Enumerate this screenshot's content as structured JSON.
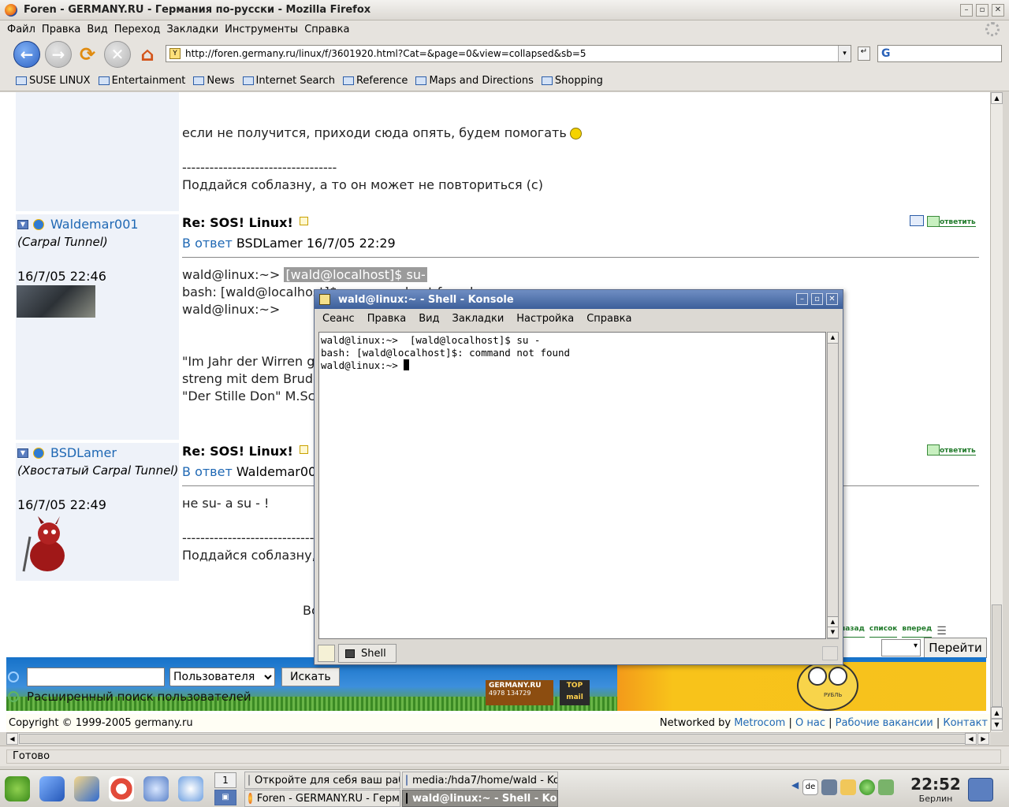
{
  "window": {
    "title": "Foren - GERMANY.RU - Германия по-русски - Mozilla Firefox",
    "controls": [
      "–",
      "▫",
      "✕"
    ]
  },
  "menu": [
    "Файл",
    "Правка",
    "Вид",
    "Переход",
    "Закладки",
    "Инструменты",
    "Справка"
  ],
  "nav": {
    "url": "http://foren.germany.ru/linux/f/3601920.html?Cat=&page=0&view=collapsed&sb=5",
    "search_engine_glyph": "G"
  },
  "bookmarks": [
    "SUSE LINUX",
    "Entertainment",
    "News",
    "Internet Search",
    "Reference",
    "Maps and Directions",
    "Shopping"
  ],
  "post0": {
    "line1": "если не получится, приходи сюда опять, будем помогать",
    "sig_dashes": "----------------------------------",
    "sig": "Поддайся соблазну, а то он может не повториться (с)"
  },
  "post1": {
    "user": "Waldemar001",
    "status": "(Carpal Tunnel)",
    "date": "16/7/05 22:46",
    "subject": "Re: SOS! Linux!",
    "reply_prefix": "В ответ",
    "reply_rest": "BSDLamer 16/7/05 22:29",
    "reply_btn": "ответить",
    "lines": [
      "wald@linux:~>",
      "[wald@localhost]$ su-",
      "bash: [wald@localhost]$: command not found",
      "wald@linux:~>"
    ],
    "quote": [
      "\"Im Jahr der Wirren ge",
      "streng mit dem Bruder",
      "\"Der Stille Don\" M.Sch"
    ]
  },
  "post2": {
    "user": "BSDLamer",
    "status": "(Хвостатый Carpal Tunnel)",
    "date": "16/7/05 22:49",
    "subject": "Re: SOS! Linux!",
    "reply_prefix": "В ответ",
    "reply_rest": "Waldemar001",
    "reply_btn": "ответить",
    "line1": "не su- а su - !",
    "sig_dashes": "-----------------------------------",
    "sig": "Поддайся соблазну, а"
  },
  "page_bottom": {
    "partial": "Вс",
    "nav": [
      "назад",
      "список",
      "вперед"
    ],
    "goto_btn": "Перейти"
  },
  "site_search": {
    "select_value": "Пользователя",
    "button": "Искать",
    "advanced": "Расширенный поиск пользователей",
    "logo_germany": "GERMANY.RU",
    "logo_counts": [
      "4978",
      "134729"
    ],
    "logo_topmail": [
      "TOP",
      "mail"
    ],
    "ad_text": "РУБЛЬ"
  },
  "footer": {
    "copyright": "Copyright © 1999-2005 germany.ru",
    "networked_by": "Networked by",
    "metrocom": "Metrocom",
    "sep": "|",
    "about": "О нас",
    "jobs": "Рабочие вакансии",
    "contact": "Контакт"
  },
  "status": "Готово",
  "konsole": {
    "title": "wald@linux:~ - Shell - Konsole",
    "menu": [
      "Сеанс",
      "Правка",
      "Вид",
      "Закладки",
      "Настройка",
      "Справка"
    ],
    "terminal": [
      "wald@linux:~>  [wald@localhost]$ su -",
      "bash: [wald@localhost]$: command not found",
      "wald@linux:~> "
    ],
    "tab": "Shell"
  },
  "taskbar": {
    "desktop_num": "1",
    "tasks": [
      "Откройте для себя ваш раб",
      "media:/hda7/home/wald - Kon",
      "Foren - GERMANY.RU - Герм",
      "wald@linux:~ - Shell - Kons"
    ],
    "keyboard": "de",
    "clock": "22:52",
    "city": "Берлин"
  }
}
